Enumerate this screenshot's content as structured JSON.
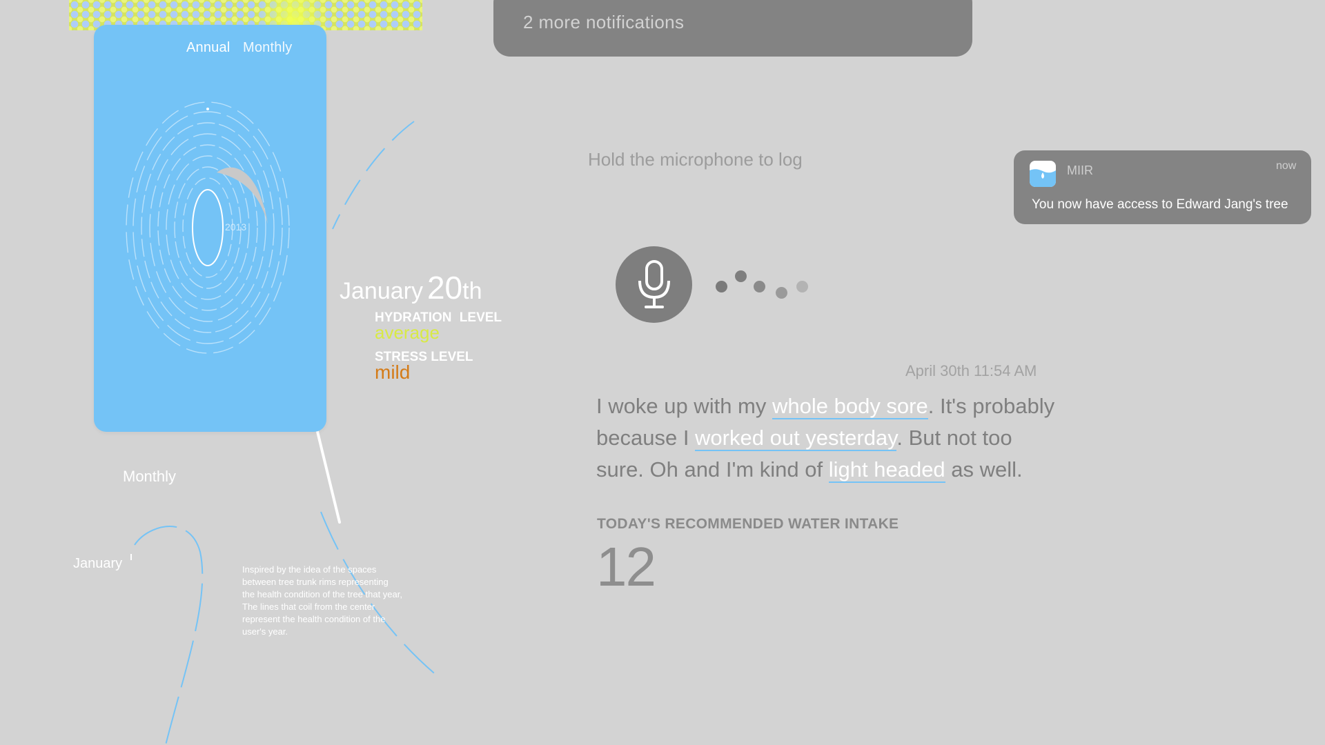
{
  "app_card": {
    "tabs": [
      "Annual",
      "Monthly"
    ],
    "fingerprint_year": "2013"
  },
  "daily_summary": {
    "month": "January",
    "day": "20",
    "day_suffix": "th",
    "hydration_label": "HYDRATION LEVEL",
    "hydration_value": "average",
    "stress_label": "STRESS LEVEL",
    "stress_value": "mild"
  },
  "timeline": {
    "view_label": "Monthly",
    "month_label": "January",
    "caption": "Inspired by the idea of the spaces between tree trunk rims representing the health condition of the tree that year, The lines that coil from the center represent the health condition of the user's year."
  },
  "notifications": {
    "more_text": "2  more  notifications",
    "toast": {
      "app_name": "MIIR",
      "time": "now",
      "message": "You now have access to Edward Jang's tree",
      "icon": "water-drop-app-icon"
    }
  },
  "voice_log": {
    "hint": "Hold the microphone to log",
    "timestamp": "April 30th 11:54 AM",
    "transcript": {
      "p1": "I woke up with my ",
      "h1": "whole body sore",
      "p2": ". It's probably because I ",
      "h2": "worked out yesterday",
      "p3": ". But not too sure. Oh and I'm kind of ",
      "h3": "light headed",
      "p4": " as well."
    },
    "water_label": "TODAY'S RECOMMENDED WATER INTAKE",
    "water_value": "12"
  },
  "colors": {
    "background": "#d3d3d3",
    "card_blue": "#74c3f6",
    "hydration_green": "#d8ea45",
    "stress_orange": "#d47b17",
    "notification_gray": "#838383"
  }
}
